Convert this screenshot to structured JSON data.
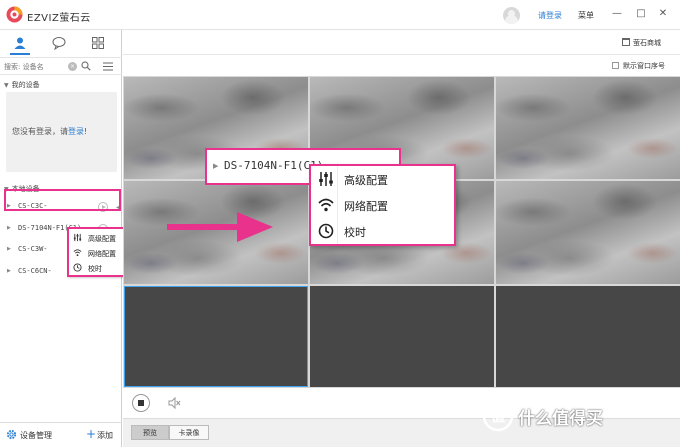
{
  "app": {
    "name": "EZVIZ萤石云",
    "login_link": "请登录",
    "menu": "菜单"
  },
  "left": {
    "search_placeholder": "搜索: 设备名",
    "my_devices": "我的设备",
    "login_prompt_prefix": "您没有登录，请",
    "login_prompt_link": "登录",
    "login_prompt_suffix": "!",
    "local_devices": "本地设备",
    "devices": [
      {
        "name": "CS-C3C-"
      },
      {
        "name": "DS-7104N-F1(C1)"
      },
      {
        "name": "CS-C3W-"
      },
      {
        "name": "CS-C6CN-"
      }
    ],
    "context_menu": [
      "高级配置",
      "网络配置",
      "校时"
    ],
    "device_manage": "设备管理",
    "add": "添加"
  },
  "right": {
    "store": "萤石商城",
    "show_window_no": "默示窗口序号",
    "big_label": "DS-7104N-F1(C1)",
    "big_menu": [
      "高级配置",
      "网络配置",
      "校时"
    ],
    "mode_tabs": [
      "预览",
      "卡录像"
    ]
  },
  "watermark": "值 什么值得买",
  "colors": {
    "accent": "#2a7ed3",
    "highlight": "#e8328b",
    "selected_cell": "#3ea3f0"
  },
  "icons": [
    "ezviz-logo-icon",
    "user-icon",
    "chat-icon",
    "grid-icon",
    "search-icon",
    "list-icon",
    "play-icon",
    "sliders-icon",
    "wifi-icon",
    "clock-icon",
    "gear-icon",
    "plus-icon",
    "store-icon",
    "stop-icon",
    "mute-icon",
    "arrow-icon"
  ]
}
